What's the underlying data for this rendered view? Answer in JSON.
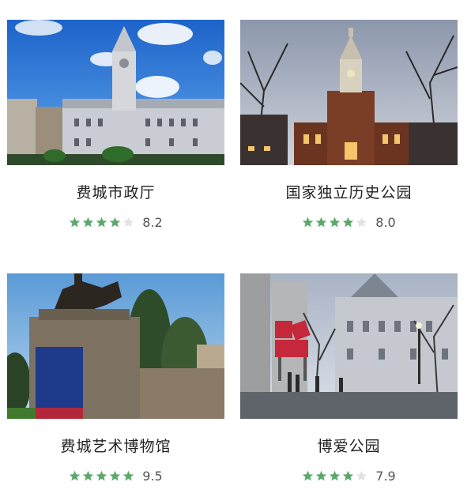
{
  "colors": {
    "star_filled": "#5aa96b",
    "star_empty": "#e2e2e2",
    "title_text": "#222222",
    "score_text": "#555555"
  },
  "attractions": [
    {
      "name": "费城市政厅",
      "score": "8.2",
      "stars": 4,
      "image_subject": "city-hall-photo"
    },
    {
      "name": "国家独立历史公园",
      "score": "8.0",
      "stars": 4,
      "image_subject": "independence-hall-photo"
    },
    {
      "name": "费城艺术博物馆",
      "score": "9.5",
      "stars": 5,
      "image_subject": "museum-sign-statue-photo"
    },
    {
      "name": "博爱公园",
      "score": "7.9",
      "stars": 4,
      "image_subject": "love-park-photo"
    }
  ]
}
